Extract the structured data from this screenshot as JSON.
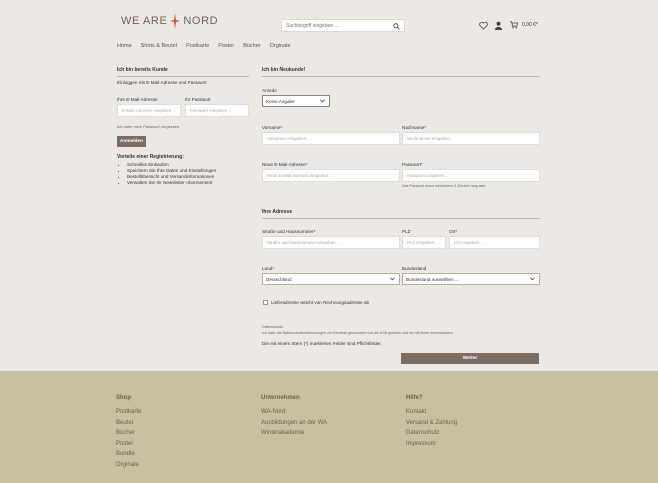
{
  "header": {
    "logo_left": "WE ARE",
    "logo_right": "NORD",
    "search_placeholder": "Suchbegriff eingeben ...",
    "cart_total": "0,00 €*"
  },
  "nav": [
    "Home",
    "Shirts & Beutel",
    "Postkarte",
    "Poster",
    "Bücher",
    "Orginale"
  ],
  "login": {
    "title": "Ich bin bereits Kunde",
    "subtitle": "Einloggen mit E-Mail-Adresse und Passwort",
    "email_label": "Ihre E-Mail-Adresse",
    "email_placeholder": "E-Mail-Adresse eingeben ...",
    "password_label": "Ihr Passwort",
    "password_placeholder": "Passwort eingeben ...",
    "forgot": "Ich habe mein Passwort vergessen.",
    "submit": "Anmelden",
    "benefits_title": "Vorteile einer Registrierung:",
    "benefits": [
      "Schnelles Einkaufen",
      "Speichern Sie Ihre Daten und Einstellungen",
      "Bestellübersicht und Versandinformationen",
      "Verwalten Sie Ihr Newsletter-Abonnement"
    ]
  },
  "register": {
    "title": "Ich bin Neukunde!",
    "salutation_label": "Anrede",
    "salutation_value": "Keine Angabe",
    "firstname_label": "Vorname*",
    "firstname_placeholder": "Vornamen eingeben ...",
    "lastname_label": "Nachname*",
    "lastname_placeholder": "Nachnamen eingeben ...",
    "email_label": "Neue E-Mail-Adresse*",
    "email_placeholder": "Neue E-Mail-Adresse eingeben ...",
    "password_label": "Passwort*",
    "password_placeholder": "Passwort eingeben ...",
    "password_hint": "Das Passwort muss mindestens 8 Zeichen lang sein.",
    "address_title": "Ihre Adresse",
    "street_label": "Straße und Hausnummer*",
    "street_placeholder": "Straße und Hausnummer eingeben ...",
    "zip_label": "PLZ",
    "zip_placeholder": "PLZ eingeben ...",
    "city_label": "Ort*",
    "city_placeholder": "Ort eingeben ...",
    "country_label": "Land*",
    "country_value": "Deutschland",
    "state_label": "Bundesland",
    "state_value": "Bundesland auswählen ...",
    "shipping_checkbox": "Lieferadresse weicht von Rechnungsadresse ab",
    "privacy_title": "Datenschutz",
    "privacy_text": "Ich habe die Datenschutzbestimmungen zur Kenntnis genommen und die AGB gelesen und bin mit ihnen einverstanden.",
    "required_note": "Die mit einem Stern (*) markierten Felder sind Pflichtfelder.",
    "submit": "Weiter"
  },
  "footer": {
    "shop_title": "Shop",
    "shop_links": [
      "Postkarte",
      "Beutel",
      "Bücher",
      "Poster",
      "Bundle",
      "Orginale"
    ],
    "company_title": "Unternehmen",
    "company_links": [
      "WA-Nord",
      "Ausbildungen an der WA",
      "Winterakademie"
    ],
    "help_title": "Hilfe?",
    "help_links": [
      "Kontakt",
      "Versand & Zahlung",
      "Datenschutz",
      "Impressum"
    ]
  },
  "colors": {
    "background": "#ece9e4",
    "accent": "#7b6c64",
    "footer": "#c9bfa1"
  }
}
